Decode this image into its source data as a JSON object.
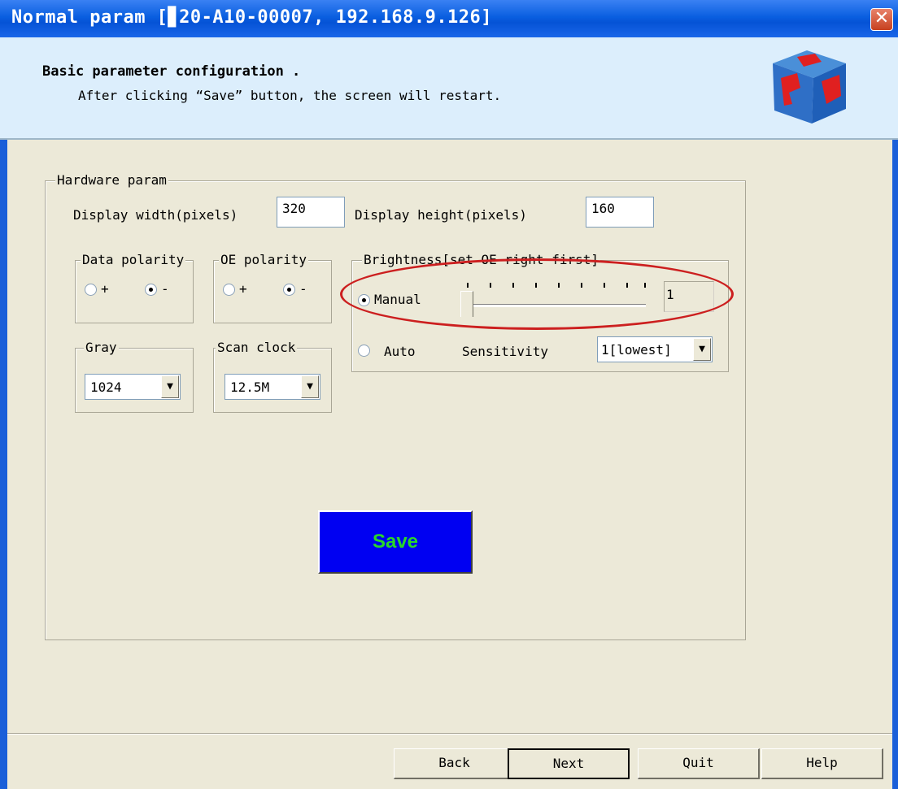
{
  "window": {
    "title": "Normal param [▊20-A10-00007, 192.168.9.126]",
    "close_glyph": "✕"
  },
  "header": {
    "title": "Basic parameter configuration .",
    "subtitle": "After clicking “Save” button, the screen will restart."
  },
  "hardware": {
    "group_label": "Hardware param",
    "width_label": "Display width(pixels)",
    "width_value": "320",
    "height_label": "Display height(pixels)",
    "height_value": "160"
  },
  "data_polarity": {
    "label": "Data polarity",
    "options": [
      "+",
      "-"
    ],
    "selected": "-"
  },
  "oe_polarity": {
    "label": "OE polarity",
    "options": [
      "+",
      "-"
    ],
    "selected": "-"
  },
  "gray": {
    "label": "Gray",
    "value": "1024"
  },
  "scan_clock": {
    "label": "Scan clock",
    "value": "12.5M"
  },
  "brightness": {
    "label": "Brightness[set OE right first]",
    "manual_label": "Manual",
    "auto_label": "Auto",
    "mode": "Manual",
    "slider_value": "1",
    "sensitivity_label": "Sensitivity",
    "sensitivity_value": "1[lowest]"
  },
  "save_label": "Save",
  "footer": {
    "back": "Back",
    "next": "Next",
    "quit": "Quit",
    "help": "Help"
  },
  "colors": {
    "titlebar": "#0553d6",
    "header_bg": "#dceefc",
    "dialog_bg": "#ece9d8",
    "save_bg": "#0000f2",
    "save_text": "#29d629",
    "highlight": "#cc1f1f"
  }
}
